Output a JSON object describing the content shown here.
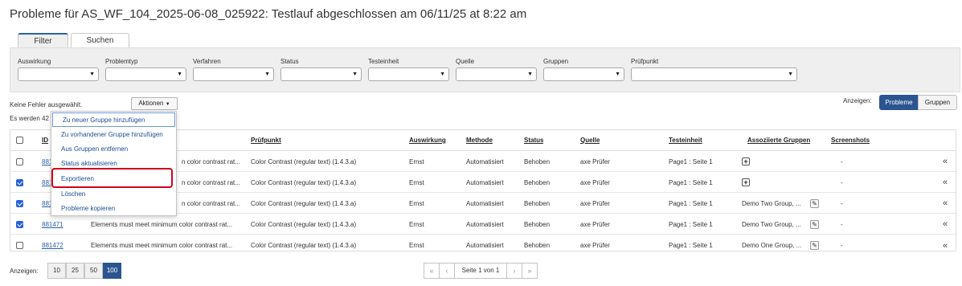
{
  "page_title": "Probleme für AS_WF_104_2025-06-08_025922: Testlauf abgeschlossen am 06/11/25 at 8:22 am",
  "tabs": [
    "Filter",
    "Suchen"
  ],
  "filters": [
    "Auswirkung",
    "Problemtyp",
    "Verfahren",
    "Status",
    "Testeinheit",
    "Quelle",
    "Gruppen",
    "Prüfpunkt"
  ],
  "toolbar": {
    "no_errors_text": "Keine Fehler ausgewählt.",
    "count_text": "Es werden 42",
    "actions_label": "Aktionen",
    "show_label": "Anzeigen:",
    "view_problems": "Probleme",
    "view_groups": "Gruppen"
  },
  "actions_menu": [
    "Zu neuer Gruppe hinzufügen",
    "Zu vorhandener Gruppe hinzufügen",
    "Aus Gruppen entfernen",
    "Status aktualisieren",
    "Exportieren",
    "Löschen",
    "Probleme kopieren"
  ],
  "table": {
    "headers": {
      "id": "ID",
      "checkpoint": "Prüfpunkt",
      "impact": "Auswirkung",
      "method": "Methode",
      "status": "Status",
      "source": "Quelle",
      "test_unit": "Testeinheit",
      "groups": "Assoziierte Gruppen",
      "screenshots": "Screenshots"
    },
    "rows": [
      {
        "id": "881",
        "description": "n color contrast rat...",
        "checkpoint": "Color Contrast (regular text) (1.4.3.a)",
        "impact": "Ernst",
        "method": "Automatisiert",
        "status": "Behoben",
        "source": "axe Prüfer",
        "test_unit": "Page1 : Seite 1",
        "groups": "",
        "screenshots": "-",
        "checked": false
      },
      {
        "id": "881",
        "description": "n color contrast rat...",
        "checkpoint": "Color Contrast (regular text) (1.4.3.a)",
        "impact": "Ernst",
        "method": "Automatisiert",
        "status": "Behoben",
        "source": "axe Prüfer",
        "test_unit": "Page1 : Seite 1",
        "groups": "",
        "screenshots": "-",
        "checked": true
      },
      {
        "id": "881",
        "description": "n color contrast rat...",
        "checkpoint": "Color Contrast (regular text) (1.4.3.a)",
        "impact": "Ernst",
        "method": "Automatisiert",
        "status": "Behoben",
        "source": "axe Prüfer",
        "test_unit": "Page1 : Seite 1",
        "groups": "Demo Two Group, ...",
        "screenshots": "-",
        "checked": true
      },
      {
        "id": "881471",
        "description": "Elements must meet minimum color contrast rat...",
        "checkpoint": "Color Contrast (regular text) (1.4.3.a)",
        "impact": "Ernst",
        "method": "Automatisiert",
        "status": "Behoben",
        "source": "axe Prüfer",
        "test_unit": "Page1 : Seite 1",
        "groups": "Demo Two Group, ...",
        "screenshots": "-",
        "checked": true
      },
      {
        "id": "881472",
        "description": "Elements must meet minimum color contrast rat...",
        "checkpoint": "Color Contrast (regular text) (1.4.3.a)",
        "impact": "Ernst",
        "method": "Automatisiert",
        "status": "Behoben",
        "source": "axe Prüfer",
        "test_unit": "Page1 : Seite 1",
        "groups": "Demo One Group, ...",
        "screenshots": "-",
        "checked": false
      }
    ]
  },
  "footer": {
    "show_label": "Anzeigen:",
    "page_sizes": [
      "10",
      "25",
      "50",
      "100"
    ],
    "active_page_size": "100",
    "page_label": "Seite 1 von 1"
  },
  "icons": {
    "plus": "+",
    "edit": "✎",
    "collapse": "«",
    "first": "«",
    "prev": "‹",
    "next": "›",
    "last": "»",
    "caret": "▼"
  },
  "colors": {
    "accent": "#2a5590",
    "link": "#2a62a8",
    "highlight": "#d0021b"
  }
}
